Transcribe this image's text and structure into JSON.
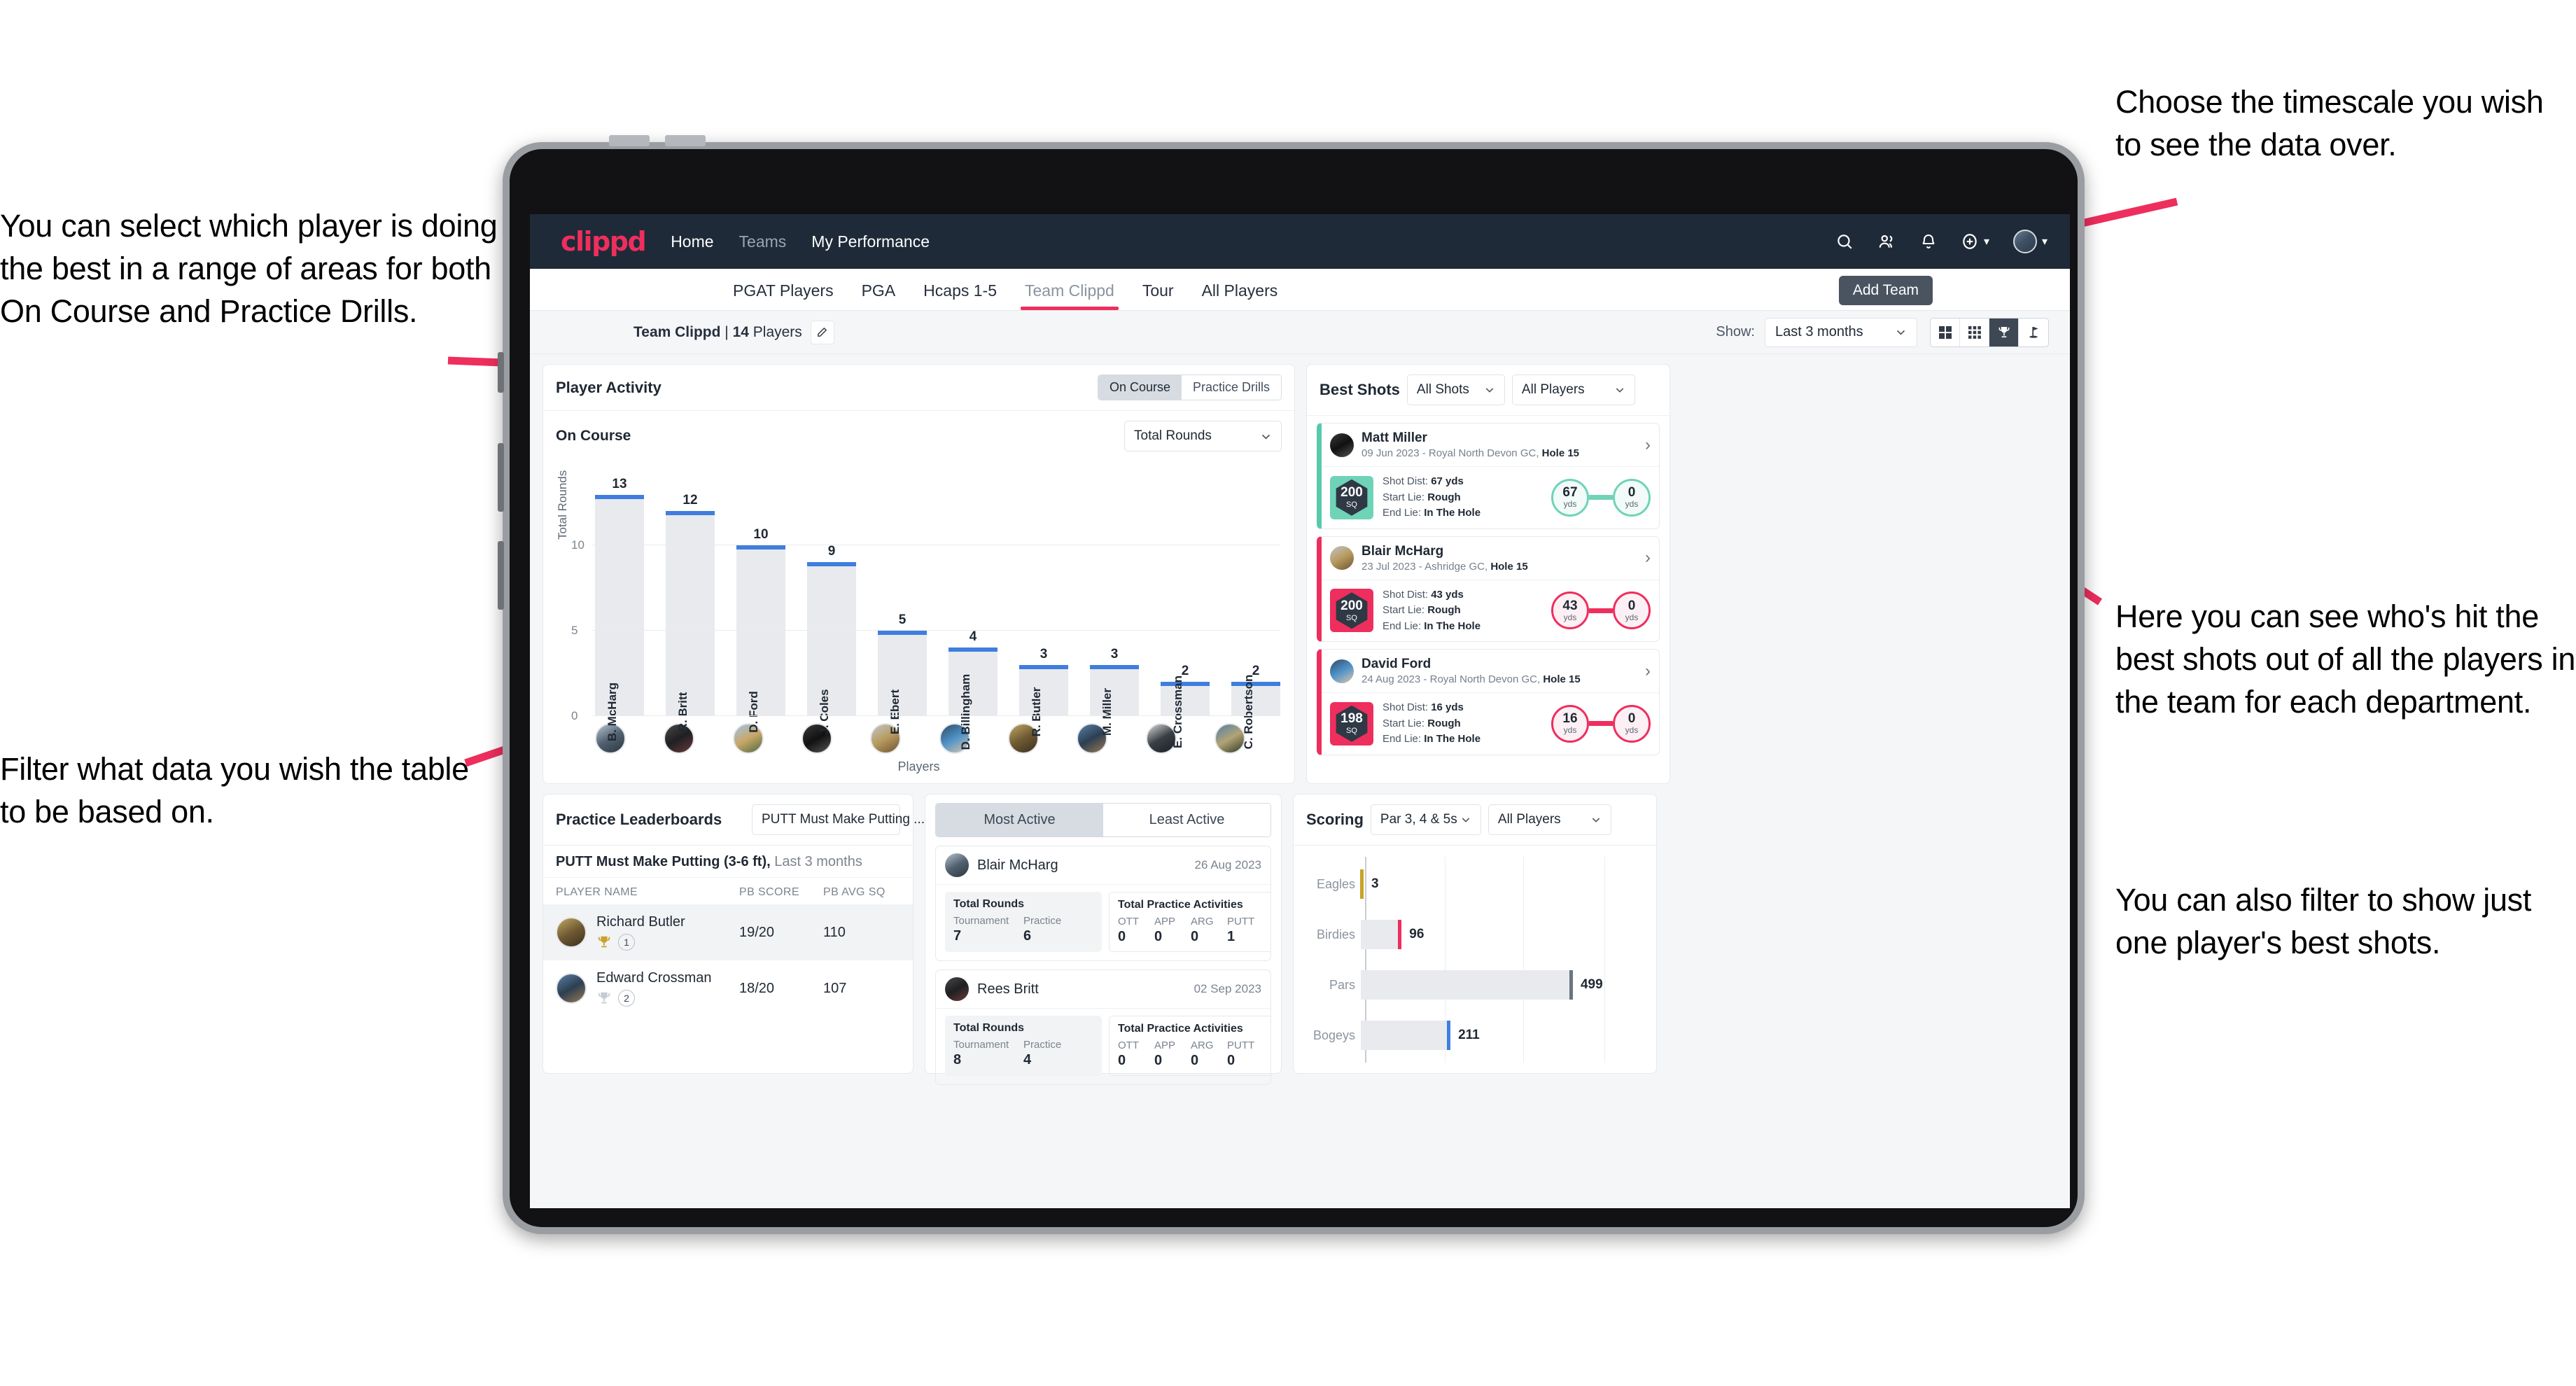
{
  "annotations": {
    "left_top": "You can select which player is doing the best in a range of areas for both On Course and Practice Drills.",
    "left_bottom": "Filter what data you wish the table to be based on.",
    "right_top": "Choose the timescale you wish to see the data over.",
    "right_middle": "Here you can see who's hit the best shots out of all the players in the team for each department.",
    "right_bottom": "You can also filter to show just one player's best shots."
  },
  "navbar": {
    "brand": "clippd",
    "links": [
      {
        "label": "Home",
        "active": true
      },
      {
        "label": "Teams",
        "active": false
      },
      {
        "label": "My Performance",
        "active": true
      }
    ],
    "icons": [
      "search-icon",
      "people-icon",
      "bell-icon",
      "plus-circle-icon",
      "avatar-icon"
    ]
  },
  "tabs": [
    {
      "label": "PGAT Players",
      "active": false
    },
    {
      "label": "PGA",
      "active": false
    },
    {
      "label": "Hcaps 1-5",
      "active": false
    },
    {
      "label": "Team Clippd",
      "active": true
    },
    {
      "label": "Tour",
      "active": false
    },
    {
      "label": "All Players",
      "active": false
    }
  ],
  "tooltip": {
    "add_team": "Add Team"
  },
  "subbar": {
    "team_name": "Team Clippd",
    "separator": " | ",
    "player_count": "14",
    "players_word": " Players",
    "edit_icon": "pencil-icon",
    "show_label": "Show:",
    "period_value": "Last 3 months",
    "view_modes": [
      {
        "name": "grid-large-icon",
        "active": false
      },
      {
        "name": "grid-small-icon",
        "active": false
      },
      {
        "name": "trophy-icon",
        "active": true
      },
      {
        "name": "golf-flag-icon",
        "active": false
      }
    ]
  },
  "player_activity": {
    "title": "Player Activity",
    "segments": [
      {
        "label": "On Course",
        "active": true
      },
      {
        "label": "Practice Drills",
        "active": false
      }
    ],
    "sub_label": "On Course",
    "metric_select": "Total Rounds"
  },
  "chart_data": {
    "type": "bar",
    "title": "Player Activity - On Course",
    "xlabel": "Players",
    "ylabel": "Total Rounds",
    "ylim": [
      0,
      14
    ],
    "yticks": [
      0,
      5,
      10
    ],
    "grid": true,
    "categories": [
      "B. McHarg",
      "R. Britt",
      "D. Ford",
      "J. Coles",
      "E. Ebert",
      "D. Billingham",
      "R. Butler",
      "M. Miller",
      "E. Crossman",
      "C. Robertson"
    ],
    "values": [
      13,
      12,
      10,
      9,
      5,
      4,
      3,
      3,
      2,
      2
    ]
  },
  "best_shots": {
    "title": "Best Shots",
    "shot_filter": "All Shots",
    "player_filter": "All Players",
    "shots": [
      {
        "player": "Matt Miller",
        "meta_date": "09 Jun 2023",
        "meta_course": "Royal North Devon GC,",
        "meta_hole": "Hole 15",
        "sq_value": "200",
        "sq_unit": "SQ",
        "shot_dist_label": "Shot Dist: ",
        "shot_dist": "67 yds",
        "start_lie_label": "Start Lie: ",
        "start_lie": "Rough",
        "end_lie_label": "End Lie: ",
        "end_lie": "In The Hole",
        "from_value": "67",
        "from_unit": "yds",
        "to_value": "0",
        "to_unit": "yds",
        "accent": "teal"
      },
      {
        "player": "Blair McHarg",
        "meta_date": "23 Jul 2023",
        "meta_course": "Ashridge GC,",
        "meta_hole": "Hole 15",
        "sq_value": "200",
        "sq_unit": "SQ",
        "shot_dist_label": "Shot Dist: ",
        "shot_dist": "43 yds",
        "start_lie_label": "Start Lie: ",
        "start_lie": "Rough",
        "end_lie_label": "End Lie: ",
        "end_lie": "In The Hole",
        "from_value": "43",
        "from_unit": "yds",
        "to_value": "0",
        "to_unit": "yds",
        "accent": "pink"
      },
      {
        "player": "David Ford",
        "meta_date": "24 Aug 2023",
        "meta_course": "Royal North Devon GC,",
        "meta_hole": "Hole 15",
        "sq_value": "198",
        "sq_unit": "SQ",
        "shot_dist_label": "Shot Dist: ",
        "shot_dist": "16 yds",
        "start_lie_label": "Start Lie: ",
        "start_lie": "Rough",
        "end_lie_label": "End Lie: ",
        "end_lie": "In The Hole",
        "from_value": "16",
        "from_unit": "yds",
        "to_value": "0",
        "to_unit": "yds",
        "accent": "pink"
      }
    ]
  },
  "practice_leaderboards": {
    "title": "Practice Leaderboards",
    "drill_select": "PUTT Must Make Putting ...",
    "sub_bold": "PUTT Must Make Putting (3-6 ft),",
    "sub_light": " Last 3 months",
    "columns": [
      "PLAYER NAME",
      "PB SCORE",
      "PB AVG SQ"
    ],
    "rows": [
      {
        "name": "Richard Butler",
        "rank": "1",
        "trophy": "gold",
        "pb_score": "19/20",
        "pb_avg_sq": "110",
        "highlight": true
      },
      {
        "name": "Edward Crossman",
        "rank": "2",
        "trophy": "silver",
        "pb_score": "18/20",
        "pb_avg_sq": "107",
        "highlight": false
      }
    ]
  },
  "activity_panel": {
    "tabs": [
      {
        "label": "Most Active",
        "active": true
      },
      {
        "label": "Least Active",
        "active": false
      }
    ],
    "cards": [
      {
        "name": "Blair McHarg",
        "date": "26 Aug 2023",
        "rounds_title": "Total Rounds",
        "rounds_keys": [
          "Tournament",
          "Practice"
        ],
        "rounds_vals": [
          "7",
          "6"
        ],
        "practice_title": "Total Practice Activities",
        "practice_keys": [
          "OTT",
          "APP",
          "ARG",
          "PUTT"
        ],
        "practice_vals": [
          "0",
          "0",
          "0",
          "1"
        ]
      },
      {
        "name": "Rees Britt",
        "date": "02 Sep 2023",
        "rounds_title": "Total Rounds",
        "rounds_keys": [
          "Tournament",
          "Practice"
        ],
        "rounds_vals": [
          "8",
          "4"
        ],
        "practice_title": "Total Practice Activities",
        "practice_keys": [
          "OTT",
          "APP",
          "ARG",
          "PUTT"
        ],
        "practice_vals": [
          "0",
          "0",
          "0",
          "0"
        ]
      }
    ]
  },
  "scoring": {
    "title": "Scoring",
    "par_filter": "Par 3, 4 & 5s",
    "player_filter": "All Players",
    "chart": {
      "type": "bar",
      "orientation": "horizontal",
      "title": "Scoring",
      "categories": [
        "Eagles",
        "Birdies",
        "Pars",
        "Bogeys"
      ],
      "values": [
        3,
        96,
        499,
        211
      ],
      "xlim": [
        0,
        560
      ],
      "grid": true,
      "colors": [
        "#c9a227",
        "#ee2e5d",
        "#6b7480",
        "#3f7ede"
      ]
    }
  },
  "colors": {
    "brand_pink": "#ee2e5d",
    "navbar": "#1e2a38",
    "bar_blue": "#3f7ede",
    "teal": "#6fd3b8"
  }
}
